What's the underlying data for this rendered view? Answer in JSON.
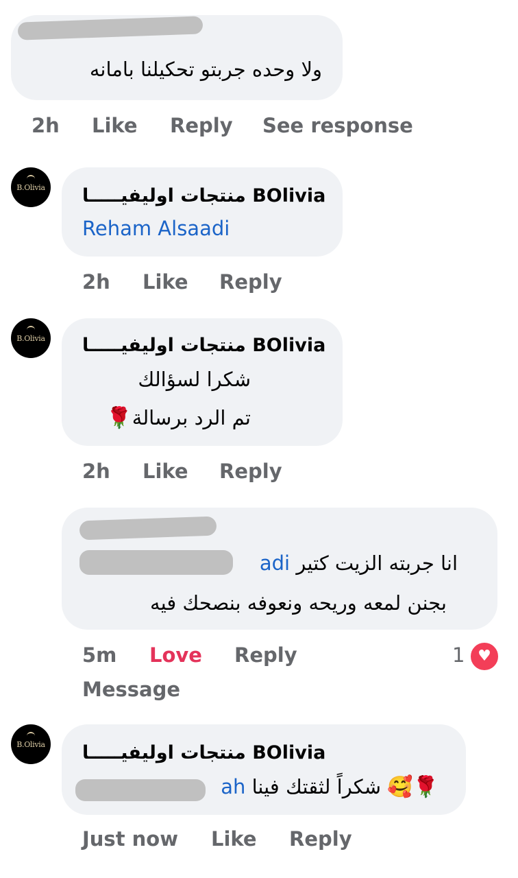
{
  "comment1": {
    "author_redacted": true,
    "text": "ولا وحده جربتو تحكيلنا بامانه",
    "time": "2h",
    "like": "Like",
    "reply": "Reply",
    "see_response": "See response"
  },
  "reply1": {
    "avatar_label": "B.Olivia",
    "author": "منتجات اوليفيـــــا BOlivia",
    "mention": "Reham Alsaadi",
    "time": "2h",
    "like": "Like",
    "reply": "Reply"
  },
  "reply2": {
    "avatar_label": "B.Olivia",
    "author": "منتجات اوليفيـــــا BOlivia",
    "line1": "شكرا لسؤالك",
    "line2": "تم الرد برسالة",
    "line2_emoji": "🌹",
    "time": "2h",
    "like": "Like",
    "reply": "Reply"
  },
  "comment2": {
    "author_redacted": true,
    "mention_tail": "adi",
    "line1": "انا جربته الزيت كتير",
    "line2": "بجنن لمعه وريحه ونعوفه  بنصحك فيه",
    "time": "5m",
    "love": "Love",
    "reply": "Reply",
    "message": "Message",
    "reaction_count": "1",
    "reaction_icon": "heart-icon"
  },
  "reply3": {
    "avatar_label": "B.Olivia",
    "author": "منتجات اوليفيـــــا BOlivia",
    "mention_tail": "ah",
    "text": "شكراً لثقتك فينا",
    "emojis": "🥰🌹",
    "time": "Just now",
    "like": "Like",
    "reply": "Reply"
  },
  "colors": {
    "bubble": "#f0f2f5",
    "meta": "#65676b",
    "link": "#1b64c8",
    "love": "#e4335a"
  }
}
